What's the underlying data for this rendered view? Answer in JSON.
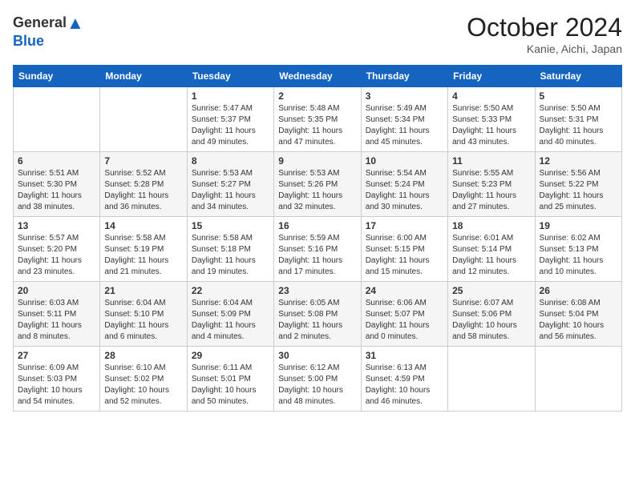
{
  "header": {
    "logo_general": "General",
    "logo_blue": "Blue",
    "month": "October 2024",
    "location": "Kanie, Aichi, Japan"
  },
  "weekdays": [
    "Sunday",
    "Monday",
    "Tuesday",
    "Wednesday",
    "Thursday",
    "Friday",
    "Saturday"
  ],
  "weeks": [
    [
      {
        "day": "",
        "info": ""
      },
      {
        "day": "",
        "info": ""
      },
      {
        "day": "1",
        "info": "Sunrise: 5:47 AM\nSunset: 5:37 PM\nDaylight: 11 hours\nand 49 minutes."
      },
      {
        "day": "2",
        "info": "Sunrise: 5:48 AM\nSunset: 5:35 PM\nDaylight: 11 hours\nand 47 minutes."
      },
      {
        "day": "3",
        "info": "Sunrise: 5:49 AM\nSunset: 5:34 PM\nDaylight: 11 hours\nand 45 minutes."
      },
      {
        "day": "4",
        "info": "Sunrise: 5:50 AM\nSunset: 5:33 PM\nDaylight: 11 hours\nand 43 minutes."
      },
      {
        "day": "5",
        "info": "Sunrise: 5:50 AM\nSunset: 5:31 PM\nDaylight: 11 hours\nand 40 minutes."
      }
    ],
    [
      {
        "day": "6",
        "info": "Sunrise: 5:51 AM\nSunset: 5:30 PM\nDaylight: 11 hours\nand 38 minutes."
      },
      {
        "day": "7",
        "info": "Sunrise: 5:52 AM\nSunset: 5:28 PM\nDaylight: 11 hours\nand 36 minutes."
      },
      {
        "day": "8",
        "info": "Sunrise: 5:53 AM\nSunset: 5:27 PM\nDaylight: 11 hours\nand 34 minutes."
      },
      {
        "day": "9",
        "info": "Sunrise: 5:53 AM\nSunset: 5:26 PM\nDaylight: 11 hours\nand 32 minutes."
      },
      {
        "day": "10",
        "info": "Sunrise: 5:54 AM\nSunset: 5:24 PM\nDaylight: 11 hours\nand 30 minutes."
      },
      {
        "day": "11",
        "info": "Sunrise: 5:55 AM\nSunset: 5:23 PM\nDaylight: 11 hours\nand 27 minutes."
      },
      {
        "day": "12",
        "info": "Sunrise: 5:56 AM\nSunset: 5:22 PM\nDaylight: 11 hours\nand 25 minutes."
      }
    ],
    [
      {
        "day": "13",
        "info": "Sunrise: 5:57 AM\nSunset: 5:20 PM\nDaylight: 11 hours\nand 23 minutes."
      },
      {
        "day": "14",
        "info": "Sunrise: 5:58 AM\nSunset: 5:19 PM\nDaylight: 11 hours\nand 21 minutes."
      },
      {
        "day": "15",
        "info": "Sunrise: 5:58 AM\nSunset: 5:18 PM\nDaylight: 11 hours\nand 19 minutes."
      },
      {
        "day": "16",
        "info": "Sunrise: 5:59 AM\nSunset: 5:16 PM\nDaylight: 11 hours\nand 17 minutes."
      },
      {
        "day": "17",
        "info": "Sunrise: 6:00 AM\nSunset: 5:15 PM\nDaylight: 11 hours\nand 15 minutes."
      },
      {
        "day": "18",
        "info": "Sunrise: 6:01 AM\nSunset: 5:14 PM\nDaylight: 11 hours\nand 12 minutes."
      },
      {
        "day": "19",
        "info": "Sunrise: 6:02 AM\nSunset: 5:13 PM\nDaylight: 11 hours\nand 10 minutes."
      }
    ],
    [
      {
        "day": "20",
        "info": "Sunrise: 6:03 AM\nSunset: 5:11 PM\nDaylight: 11 hours\nand 8 minutes."
      },
      {
        "day": "21",
        "info": "Sunrise: 6:04 AM\nSunset: 5:10 PM\nDaylight: 11 hours\nand 6 minutes."
      },
      {
        "day": "22",
        "info": "Sunrise: 6:04 AM\nSunset: 5:09 PM\nDaylight: 11 hours\nand 4 minutes."
      },
      {
        "day": "23",
        "info": "Sunrise: 6:05 AM\nSunset: 5:08 PM\nDaylight: 11 hours\nand 2 minutes."
      },
      {
        "day": "24",
        "info": "Sunrise: 6:06 AM\nSunset: 5:07 PM\nDaylight: 11 hours\nand 0 minutes."
      },
      {
        "day": "25",
        "info": "Sunrise: 6:07 AM\nSunset: 5:06 PM\nDaylight: 10 hours\nand 58 minutes."
      },
      {
        "day": "26",
        "info": "Sunrise: 6:08 AM\nSunset: 5:04 PM\nDaylight: 10 hours\nand 56 minutes."
      }
    ],
    [
      {
        "day": "27",
        "info": "Sunrise: 6:09 AM\nSunset: 5:03 PM\nDaylight: 10 hours\nand 54 minutes."
      },
      {
        "day": "28",
        "info": "Sunrise: 6:10 AM\nSunset: 5:02 PM\nDaylight: 10 hours\nand 52 minutes."
      },
      {
        "day": "29",
        "info": "Sunrise: 6:11 AM\nSunset: 5:01 PM\nDaylight: 10 hours\nand 50 minutes."
      },
      {
        "day": "30",
        "info": "Sunrise: 6:12 AM\nSunset: 5:00 PM\nDaylight: 10 hours\nand 48 minutes."
      },
      {
        "day": "31",
        "info": "Sunrise: 6:13 AM\nSunset: 4:59 PM\nDaylight: 10 hours\nand 46 minutes."
      },
      {
        "day": "",
        "info": ""
      },
      {
        "day": "",
        "info": ""
      }
    ]
  ]
}
